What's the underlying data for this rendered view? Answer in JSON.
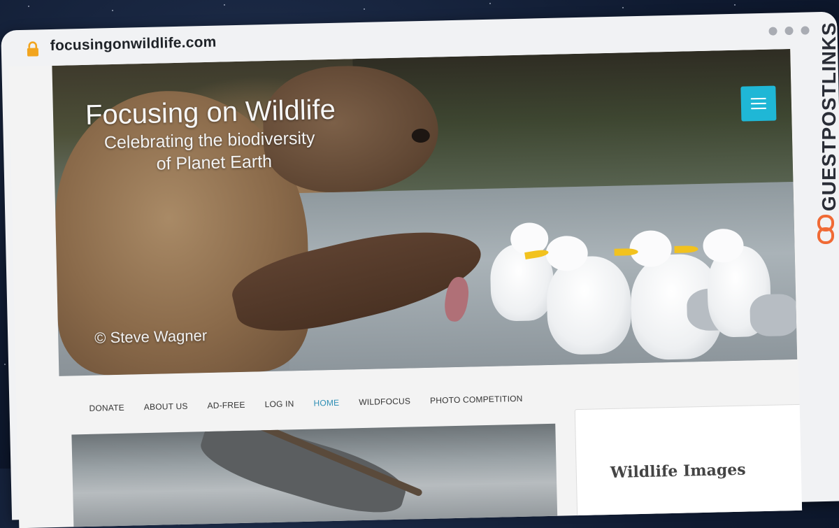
{
  "browser": {
    "url": "focusingonwildlife.com"
  },
  "hero": {
    "title": "Focusing on Wildlife",
    "subtitle_line1": "Celebrating the biodiversity",
    "subtitle_line2": "of Planet Earth",
    "credit": "© Steve Wagner"
  },
  "nav": {
    "items": [
      "DONATE",
      "ABOUT US",
      "AD-FREE",
      "LOG IN",
      "HOME",
      "WILDFOCUS",
      "PHOTO COMPETITION"
    ],
    "active": "HOME"
  },
  "sidebar": {
    "widget_title": "Wildlife Images"
  },
  "branding": {
    "text": "GUESTPOSTLINKS"
  },
  "colors": {
    "accent": "#1fb7d6",
    "nav_active": "#2f8fb5",
    "brand_orange": "#f06a35"
  },
  "icons": {
    "lock": "lock-icon",
    "menu": "hamburger-menu-icon"
  }
}
